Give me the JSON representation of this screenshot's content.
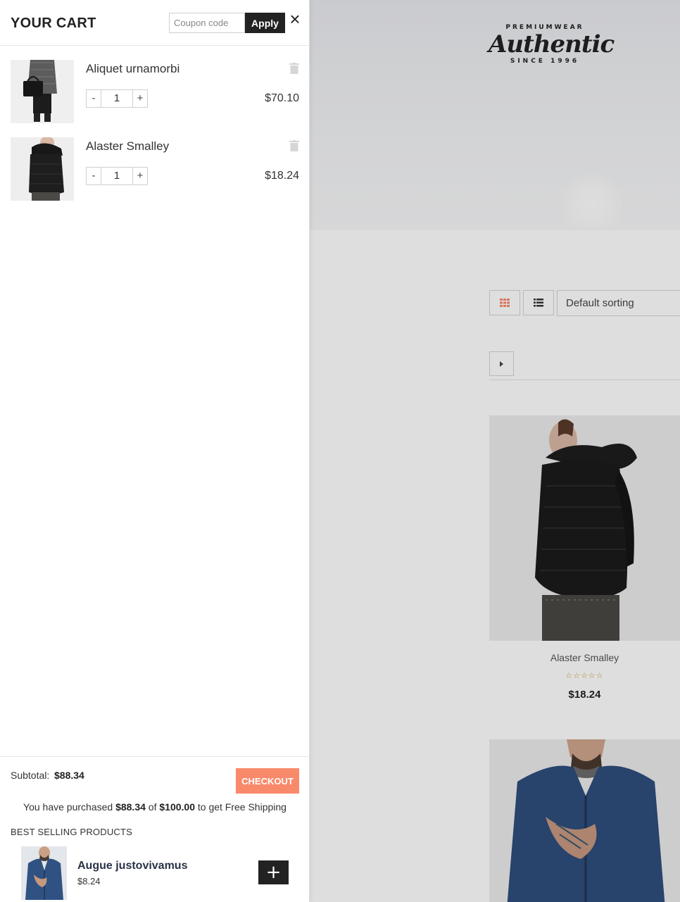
{
  "cart": {
    "title": "YOUR CART",
    "coupon_placeholder": "Coupon code",
    "apply_label": "Apply",
    "close_icon": "×",
    "items": [
      {
        "name": "Aliquet urnamorbi",
        "qty": "1",
        "price": "$70.10",
        "minus": "-",
        "plus": "+"
      },
      {
        "name": "Alaster Smalley",
        "qty": "1",
        "price": "$18.24",
        "minus": "-",
        "plus": "+"
      }
    ],
    "subtotal_label": "Subtotal:",
    "subtotal_value": "$88.34",
    "checkout_label": "CHECKOUT",
    "free_shipping": {
      "prefix": "You have purchased",
      "purchased": "$88.34",
      "of": "of",
      "target": "$100.00",
      "suffix": "to get Free Shipping"
    },
    "best_selling_title": "BEST SELLING PRODUCTS",
    "best_selling": [
      {
        "name": "Augue justovivamus",
        "price": "$8.24",
        "add_label": "+"
      }
    ]
  },
  "background": {
    "logo": {
      "top": "PREMIUMWEAR",
      "main": "Authentic",
      "bottom": "SINCE 1996"
    },
    "sort_label": "Default sorting",
    "products": [
      {
        "name": "Alaster Smalley",
        "rating": "☆☆☆☆☆",
        "price": "$18.24"
      }
    ]
  },
  "colors": {
    "accent": "#f9896b",
    "dark": "#222222",
    "star": "#c79b2f"
  }
}
